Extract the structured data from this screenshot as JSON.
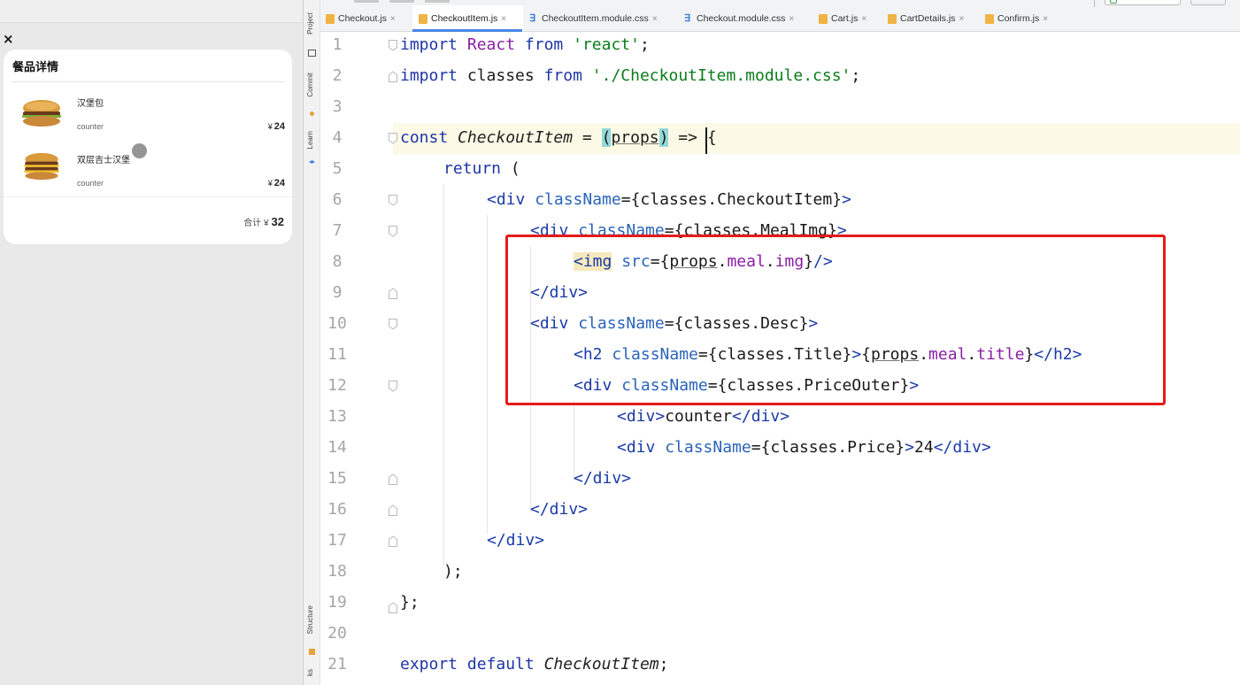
{
  "preview": {
    "close_label": "×",
    "card_title": "餐品详情",
    "currency": "¥",
    "meals": [
      {
        "name": "汉堡包",
        "counter": "counter",
        "price": "24"
      },
      {
        "name": "双层吉士汉堡",
        "counter": "counter",
        "price": "24"
      }
    ],
    "total_label": "合计",
    "total_value": "32"
  },
  "toolstrip": {
    "project": "Project",
    "commit": "Commit",
    "learn": "Learn",
    "structure": "Structure",
    "bookmarks": "ks"
  },
  "tabs": [
    {
      "label": "Checkout.js",
      "type": "js",
      "active": false
    },
    {
      "label": "CheckoutItem.js",
      "type": "js",
      "active": true
    },
    {
      "label": "CheckoutItem.module.css",
      "type": "css",
      "active": false
    },
    {
      "label": "Checkout.module.css",
      "type": "css",
      "active": false
    },
    {
      "label": "Cart.js",
      "type": "js",
      "active": false
    },
    {
      "label": "CartDetails.js",
      "type": "js",
      "active": false
    },
    {
      "label": "Confirm.js",
      "type": "js",
      "active": false
    }
  ],
  "tab_close": "×",
  "line_numbers": [
    "1",
    "2",
    "3",
    "4",
    "5",
    "6",
    "7",
    "8",
    "9",
    "10",
    "11",
    "12",
    "13",
    "14",
    "15",
    "16",
    "17",
    "18",
    "19",
    "20",
    "21"
  ],
  "code": {
    "l1": {
      "import": "import",
      "react_id": "React",
      "from": "from",
      "module": "'react'",
      "end": ";"
    },
    "l2": {
      "import": "import",
      "classes_id": "classes",
      "from": "from",
      "module": "'./CheckoutItem.module.css'",
      "end": ";"
    },
    "l4": {
      "const": "const",
      "name": "CheckoutItem",
      "eq": " = ",
      "popen": "(",
      "props": "props",
      "pclose": ")",
      "arrow": " => {"
    },
    "l5": {
      "ret": "return",
      "rest": " ("
    },
    "l6": {
      "open": "<div",
      "attr": "className",
      "eq": "=",
      "val": "{classes.CheckoutItem}",
      "close": ">"
    },
    "l7": {
      "open": "<div",
      "attr": "className",
      "eq": "=",
      "val": "{classes.MealImg}",
      "close": ">"
    },
    "l8": {
      "open": "<img",
      "attr": "src",
      "eq": "=",
      "b1": "{",
      "props": "props",
      "dot1": ".",
      "f1": "meal",
      "dot2": ".",
      "f2": "img",
      "b2": "}",
      "close": "/>"
    },
    "l9": {
      "close": "</div>"
    },
    "l10": {
      "open": "<div",
      "attr": "className",
      "eq": "=",
      "val": "{classes.Desc}",
      "close": ">"
    },
    "l11": {
      "open": "<h2",
      "attr": "className",
      "eq": "=",
      "val": "{classes.Title}",
      "gt": ">",
      "b1": "{",
      "props": "props",
      "dot1": ".",
      "f1": "meal",
      "dot2": ".",
      "f2": "title",
      "b2": "}",
      "close": "</h2>"
    },
    "l12": {
      "open": "<div",
      "attr": "className",
      "eq": "=",
      "val": "{classes.PriceOuter}",
      "close": ">"
    },
    "l13": {
      "open": "<div>",
      "text": "counter",
      "close": "</div>"
    },
    "l14": {
      "open": "<div",
      "attr": "className",
      "eq": "=",
      "val": "{classes.Price}",
      "gt": ">",
      "text": "24",
      "close": "</div>"
    },
    "l15": {
      "close": "</div>"
    },
    "l16": {
      "close": "</div>"
    },
    "l17": {
      "close": "</div>"
    },
    "l18": {
      "text": ");"
    },
    "l19": {
      "text": "};"
    },
    "l21": {
      "export": "export",
      "default": "default",
      "name": "CheckoutItem",
      "end": ";"
    }
  }
}
